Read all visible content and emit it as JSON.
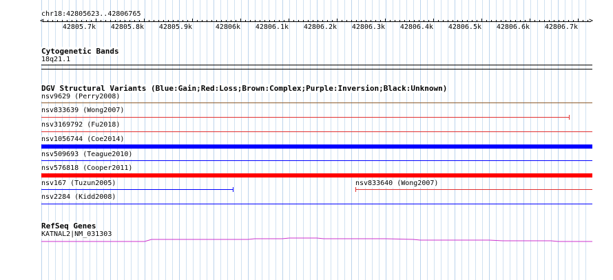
{
  "ruler": {
    "location": "chr18:42805623..42806765",
    "tick_labels": [
      "42805.7k",
      "42805.8k",
      "42805.9k",
      "42806k",
      "42806.1k",
      "42806.2k",
      "42806.3k",
      "42806.4k",
      "42806.5k",
      "42806.6k",
      "42806.7k"
    ]
  },
  "cytoband": {
    "title": "Cytogenetic Bands",
    "label": "18q21.1"
  },
  "dgv": {
    "title": "DGV Structural Variants (Blue:Gain;Red:Loss;Brown:Complex;Purple:Inversion;Black:Unknown)",
    "variants": [
      {
        "label": "nsv9629 (Perry2008)",
        "color": "#8b5a2b"
      },
      {
        "label": "nsv833639 (Wong2007)",
        "color": "#e03030"
      },
      {
        "label": "nsv3169792 (Fu2018)",
        "color": "#e03030"
      },
      {
        "label": "nsv1056744 (Coe2014)",
        "color": "#0000ff"
      },
      {
        "label": "nsv509693 (Teague2010)",
        "color": "#0000ff"
      },
      {
        "label": "nsv576818 (Cooper2011)",
        "color": "#ff0000"
      },
      {
        "label": "nsv167 (Tuzun2005)",
        "color": "#0000ff"
      },
      {
        "label": "nsv833640 (Wong2007)",
        "color": "#e03030"
      },
      {
        "label": "nsv2284 (Kidd2008)",
        "color": "#0000ff"
      }
    ]
  },
  "refseq": {
    "title": "RefSeq Genes",
    "gene_label": "KATNAL2|NM_031303",
    "color": "#cc33cc"
  },
  "colors": {
    "grid_minor": "#aac8e6",
    "grid_major": "#78aadc",
    "cytoband_line": "#000000"
  }
}
